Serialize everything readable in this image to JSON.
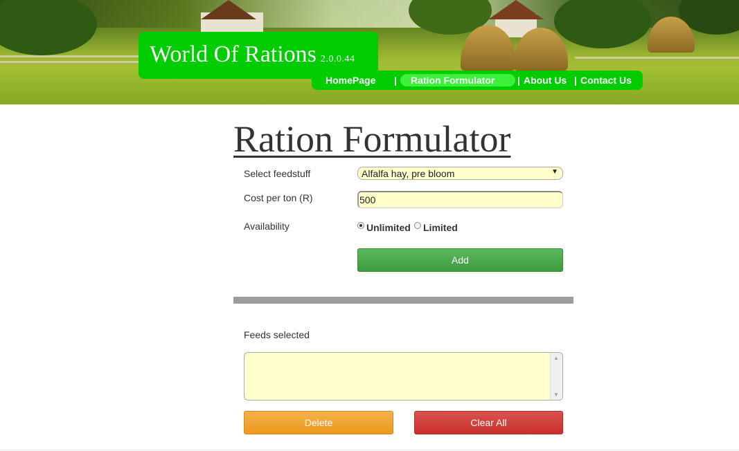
{
  "brand": {
    "title": "World Of Rations",
    "version": "2.0.0.44",
    "box_color": "#00cc00"
  },
  "nav": {
    "items": [
      {
        "label": "HomePage"
      },
      {
        "label": "Ration Formulator",
        "active": true
      },
      {
        "label": "About Us"
      },
      {
        "label": "Contact Us"
      }
    ],
    "separator": "|"
  },
  "form": {
    "title": "Ration Formulator",
    "feed_label": "Select feedstuff",
    "feed_selected": "Alfalfa hay, pre bloom",
    "cost_label": "Cost per ton (R)",
    "cost_value": "500",
    "availability_label": "Availability",
    "availability_options": [
      {
        "label": "Unlimited",
        "checked": true
      },
      {
        "label": "Limited",
        "checked": false
      }
    ],
    "add_label": "Add"
  },
  "selected": {
    "label": "Feeds selected",
    "items": []
  },
  "actions": {
    "delete_label": "Delete",
    "clear_label": "Clear All"
  },
  "colors": {
    "accent_green": "#00cc00",
    "add_button": "#4cae4c",
    "delete_button": "#f0a030",
    "clear_button": "#d9534f",
    "input_background": "#ffffcc"
  }
}
